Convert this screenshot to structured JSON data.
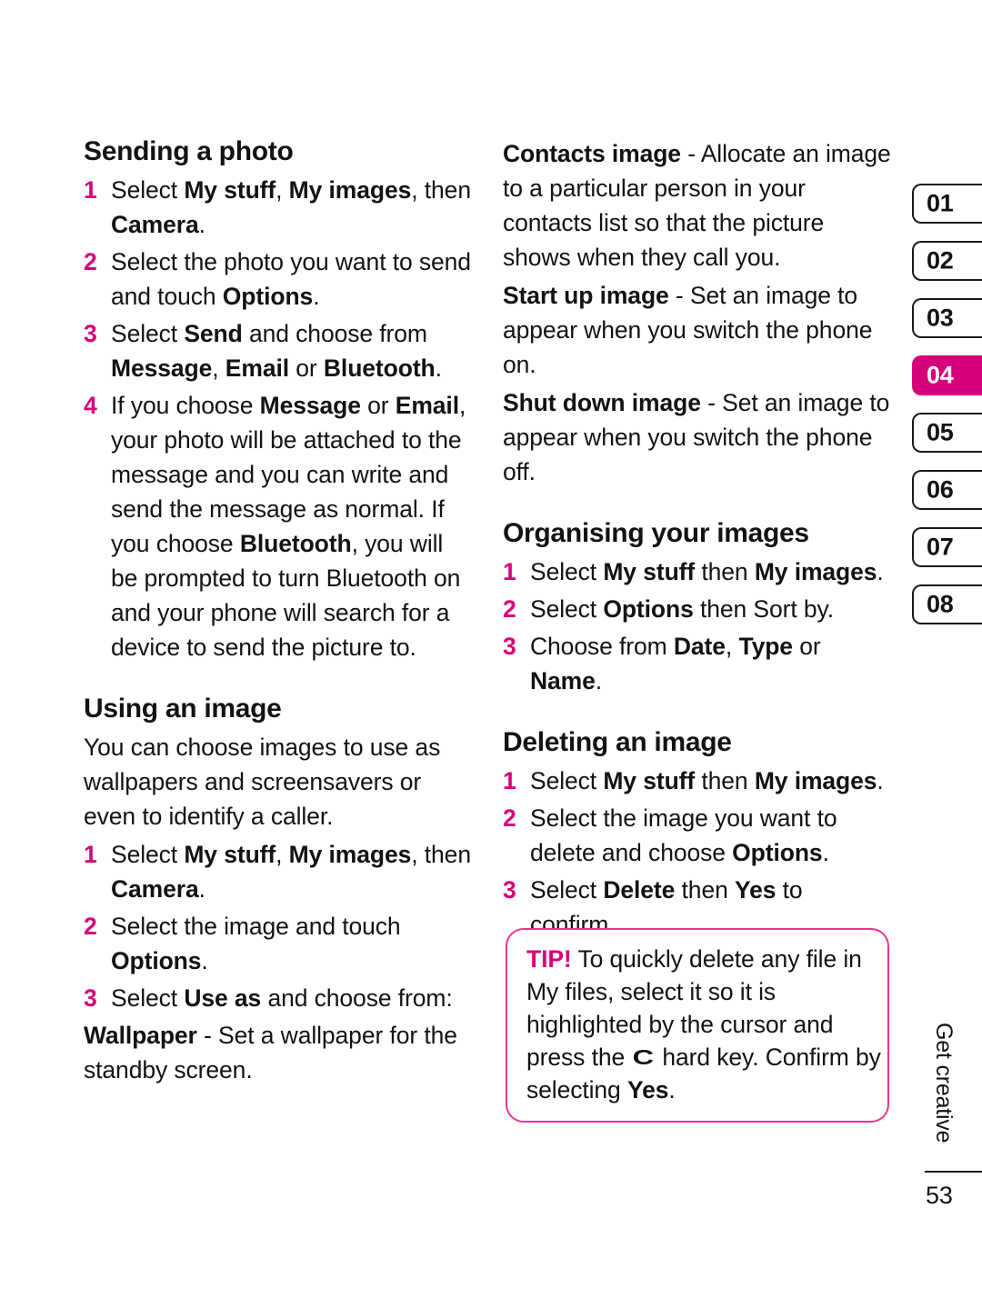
{
  "colors": {
    "accent_magenta": "#D6017B",
    "tip_border": "#E8368F",
    "text": "#131313"
  },
  "left_column": {
    "section_sending": {
      "heading": "Sending a photo",
      "steps": [
        {
          "num": "1",
          "html": "Select <b>My stuff</b>, <b>My images</b>, then <b>Camera</b>."
        },
        {
          "num": "2",
          "html": "Select the photo you want to send and touch <b>Options</b>."
        },
        {
          "num": "3",
          "html": "Select <b>Send</b> and choose from <b>Message</b>, <b>Email</b> or <b>Bluetooth</b>."
        },
        {
          "num": "4",
          "html": "If you choose <b>Message</b> or <b>Email</b>, your photo will be attached to the message and you can write and send the message as normal. If you choose <b>Bluetooth</b>, you will be prompted to turn Bluetooth on and your phone will search for a device to send the picture to."
        }
      ]
    },
    "section_using": {
      "heading": "Using an image",
      "intro": "You can choose images to use as wallpapers and screensavers or even to identify a caller.",
      "steps": [
        {
          "num": "1",
          "html": "Select <b>My stuff</b>, <b>My images</b>, then <b>Camera</b>."
        },
        {
          "num": "2",
          "html": "Select the image and touch <b>Options</b>."
        },
        {
          "num": "3",
          "html": "Select <b>Use as</b> and choose from:"
        }
      ],
      "definitions": [
        {
          "term": "Wallpaper",
          "desc": " - Set a wallpaper for the standby screen."
        }
      ]
    }
  },
  "right_column": {
    "definitions_continued": [
      {
        "term": "Contacts image",
        "desc": " - Allocate an image to a particular person in your contacts list so that the picture shows when they call you."
      },
      {
        "term": "Start up image",
        "desc": " - Set an image to appear when you switch the phone on."
      },
      {
        "term": "Shut down image",
        "desc": " - Set an image to appear when you switch the phone off."
      }
    ],
    "section_organising": {
      "heading": "Organising your images",
      "steps": [
        {
          "num": "1",
          "html": "Select <b>My stuff</b> then <b>My images</b>."
        },
        {
          "num": "2",
          "html": "Select <b>Options</b> then Sort by."
        },
        {
          "num": "3",
          "html": "Choose from <b>Date</b>, <b>Type</b> or <b>Name</b>."
        }
      ]
    },
    "section_deleting": {
      "heading": "Deleting an image",
      "steps": [
        {
          "num": "1",
          "html": "Select <b>My stuff</b> then <b>My images</b>."
        },
        {
          "num": "2",
          "html": "Select the image you want to delete and choose <b>Options</b>."
        },
        {
          "num": "3",
          "html": "Select <b>Delete</b> then <b>Yes</b> to confirm."
        }
      ]
    },
    "tip": {
      "label": "TIP!",
      "text_before_icon": " To quickly delete any file in My files, select it so it is highlighted by the cursor and press the ",
      "hard_key_glyph": "C",
      "text_after_icon": " hard key. Confirm by selecting ",
      "confirm_word": "Yes",
      "text_end": "."
    }
  },
  "chapter_tabs": {
    "items": [
      {
        "label": "01",
        "active": false
      },
      {
        "label": "02",
        "active": false
      },
      {
        "label": "03",
        "active": false
      },
      {
        "label": "04",
        "active": true
      },
      {
        "label": "05",
        "active": false
      },
      {
        "label": "06",
        "active": false
      },
      {
        "label": "07",
        "active": false
      },
      {
        "label": "08",
        "active": false
      }
    ]
  },
  "footer": {
    "chapter_label": "Get creative",
    "page_number": "53"
  }
}
